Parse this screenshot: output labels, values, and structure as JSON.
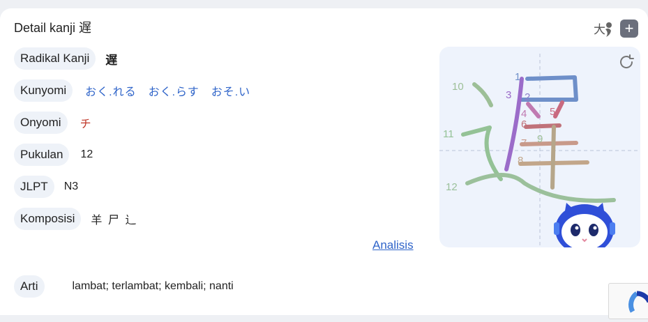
{
  "header": {
    "title": "Detail kanji 遅",
    "font_icon_char": "大"
  },
  "fields": [
    {
      "label": "Radikal Kanji",
      "value": "遅"
    },
    {
      "label": "Kunyomi",
      "value": "おく.れる　おく.らす　おそ.い"
    },
    {
      "label": "Onyomi",
      "value": "チ"
    },
    {
      "label": "Pukulan",
      "value": "12"
    },
    {
      "label": "JLPT",
      "value": "N3"
    },
    {
      "label": "Komposisi",
      "value": "羊 尸 辶"
    }
  ],
  "analysis_link": "Analisis",
  "meaning": {
    "label": "Arti",
    "value": "lambat; terlambat; kembali; nanti"
  },
  "stroke_numbers": [
    "1",
    "2",
    "3",
    "4",
    "5",
    "6",
    "7",
    "8",
    "9",
    "10",
    "11",
    "12"
  ],
  "colors": {
    "accent": "#2f64c9",
    "onyomi": "#c0392b",
    "pill_bg": "#eef2f8"
  }
}
